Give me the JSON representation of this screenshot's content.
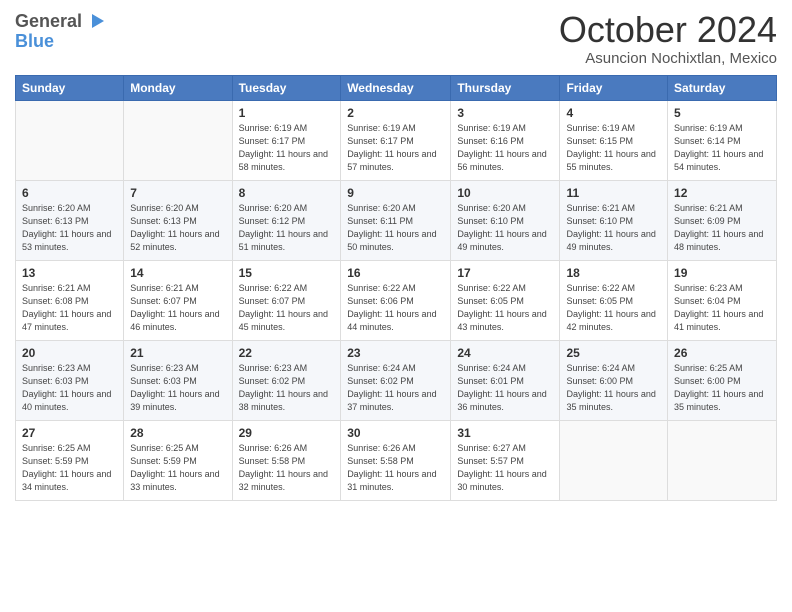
{
  "header": {
    "logo_general": "General",
    "logo_blue": "Blue",
    "month": "October 2024",
    "location": "Asuncion Nochixtlan, Mexico"
  },
  "weekdays": [
    "Sunday",
    "Monday",
    "Tuesday",
    "Wednesday",
    "Thursday",
    "Friday",
    "Saturday"
  ],
  "weeks": [
    [
      {
        "day": "",
        "sunrise": "",
        "sunset": "",
        "daylight": ""
      },
      {
        "day": "",
        "sunrise": "",
        "sunset": "",
        "daylight": ""
      },
      {
        "day": "1",
        "sunrise": "Sunrise: 6:19 AM",
        "sunset": "Sunset: 6:17 PM",
        "daylight": "Daylight: 11 hours and 58 minutes."
      },
      {
        "day": "2",
        "sunrise": "Sunrise: 6:19 AM",
        "sunset": "Sunset: 6:17 PM",
        "daylight": "Daylight: 11 hours and 57 minutes."
      },
      {
        "day": "3",
        "sunrise": "Sunrise: 6:19 AM",
        "sunset": "Sunset: 6:16 PM",
        "daylight": "Daylight: 11 hours and 56 minutes."
      },
      {
        "day": "4",
        "sunrise": "Sunrise: 6:19 AM",
        "sunset": "Sunset: 6:15 PM",
        "daylight": "Daylight: 11 hours and 55 minutes."
      },
      {
        "day": "5",
        "sunrise": "Sunrise: 6:19 AM",
        "sunset": "Sunset: 6:14 PM",
        "daylight": "Daylight: 11 hours and 54 minutes."
      }
    ],
    [
      {
        "day": "6",
        "sunrise": "Sunrise: 6:20 AM",
        "sunset": "Sunset: 6:13 PM",
        "daylight": "Daylight: 11 hours and 53 minutes."
      },
      {
        "day": "7",
        "sunrise": "Sunrise: 6:20 AM",
        "sunset": "Sunset: 6:13 PM",
        "daylight": "Daylight: 11 hours and 52 minutes."
      },
      {
        "day": "8",
        "sunrise": "Sunrise: 6:20 AM",
        "sunset": "Sunset: 6:12 PM",
        "daylight": "Daylight: 11 hours and 51 minutes."
      },
      {
        "day": "9",
        "sunrise": "Sunrise: 6:20 AM",
        "sunset": "Sunset: 6:11 PM",
        "daylight": "Daylight: 11 hours and 50 minutes."
      },
      {
        "day": "10",
        "sunrise": "Sunrise: 6:20 AM",
        "sunset": "Sunset: 6:10 PM",
        "daylight": "Daylight: 11 hours and 49 minutes."
      },
      {
        "day": "11",
        "sunrise": "Sunrise: 6:21 AM",
        "sunset": "Sunset: 6:10 PM",
        "daylight": "Daylight: 11 hours and 49 minutes."
      },
      {
        "day": "12",
        "sunrise": "Sunrise: 6:21 AM",
        "sunset": "Sunset: 6:09 PM",
        "daylight": "Daylight: 11 hours and 48 minutes."
      }
    ],
    [
      {
        "day": "13",
        "sunrise": "Sunrise: 6:21 AM",
        "sunset": "Sunset: 6:08 PM",
        "daylight": "Daylight: 11 hours and 47 minutes."
      },
      {
        "day": "14",
        "sunrise": "Sunrise: 6:21 AM",
        "sunset": "Sunset: 6:07 PM",
        "daylight": "Daylight: 11 hours and 46 minutes."
      },
      {
        "day": "15",
        "sunrise": "Sunrise: 6:22 AM",
        "sunset": "Sunset: 6:07 PM",
        "daylight": "Daylight: 11 hours and 45 minutes."
      },
      {
        "day": "16",
        "sunrise": "Sunrise: 6:22 AM",
        "sunset": "Sunset: 6:06 PM",
        "daylight": "Daylight: 11 hours and 44 minutes."
      },
      {
        "day": "17",
        "sunrise": "Sunrise: 6:22 AM",
        "sunset": "Sunset: 6:05 PM",
        "daylight": "Daylight: 11 hours and 43 minutes."
      },
      {
        "day": "18",
        "sunrise": "Sunrise: 6:22 AM",
        "sunset": "Sunset: 6:05 PM",
        "daylight": "Daylight: 11 hours and 42 minutes."
      },
      {
        "day": "19",
        "sunrise": "Sunrise: 6:23 AM",
        "sunset": "Sunset: 6:04 PM",
        "daylight": "Daylight: 11 hours and 41 minutes."
      }
    ],
    [
      {
        "day": "20",
        "sunrise": "Sunrise: 6:23 AM",
        "sunset": "Sunset: 6:03 PM",
        "daylight": "Daylight: 11 hours and 40 minutes."
      },
      {
        "day": "21",
        "sunrise": "Sunrise: 6:23 AM",
        "sunset": "Sunset: 6:03 PM",
        "daylight": "Daylight: 11 hours and 39 minutes."
      },
      {
        "day": "22",
        "sunrise": "Sunrise: 6:23 AM",
        "sunset": "Sunset: 6:02 PM",
        "daylight": "Daylight: 11 hours and 38 minutes."
      },
      {
        "day": "23",
        "sunrise": "Sunrise: 6:24 AM",
        "sunset": "Sunset: 6:02 PM",
        "daylight": "Daylight: 11 hours and 37 minutes."
      },
      {
        "day": "24",
        "sunrise": "Sunrise: 6:24 AM",
        "sunset": "Sunset: 6:01 PM",
        "daylight": "Daylight: 11 hours and 36 minutes."
      },
      {
        "day": "25",
        "sunrise": "Sunrise: 6:24 AM",
        "sunset": "Sunset: 6:00 PM",
        "daylight": "Daylight: 11 hours and 35 minutes."
      },
      {
        "day": "26",
        "sunrise": "Sunrise: 6:25 AM",
        "sunset": "Sunset: 6:00 PM",
        "daylight": "Daylight: 11 hours and 35 minutes."
      }
    ],
    [
      {
        "day": "27",
        "sunrise": "Sunrise: 6:25 AM",
        "sunset": "Sunset: 5:59 PM",
        "daylight": "Daylight: 11 hours and 34 minutes."
      },
      {
        "day": "28",
        "sunrise": "Sunrise: 6:25 AM",
        "sunset": "Sunset: 5:59 PM",
        "daylight": "Daylight: 11 hours and 33 minutes."
      },
      {
        "day": "29",
        "sunrise": "Sunrise: 6:26 AM",
        "sunset": "Sunset: 5:58 PM",
        "daylight": "Daylight: 11 hours and 32 minutes."
      },
      {
        "day": "30",
        "sunrise": "Sunrise: 6:26 AM",
        "sunset": "Sunset: 5:58 PM",
        "daylight": "Daylight: 11 hours and 31 minutes."
      },
      {
        "day": "31",
        "sunrise": "Sunrise: 6:27 AM",
        "sunset": "Sunset: 5:57 PM",
        "daylight": "Daylight: 11 hours and 30 minutes."
      },
      {
        "day": "",
        "sunrise": "",
        "sunset": "",
        "daylight": ""
      },
      {
        "day": "",
        "sunrise": "",
        "sunset": "",
        "daylight": ""
      }
    ]
  ]
}
